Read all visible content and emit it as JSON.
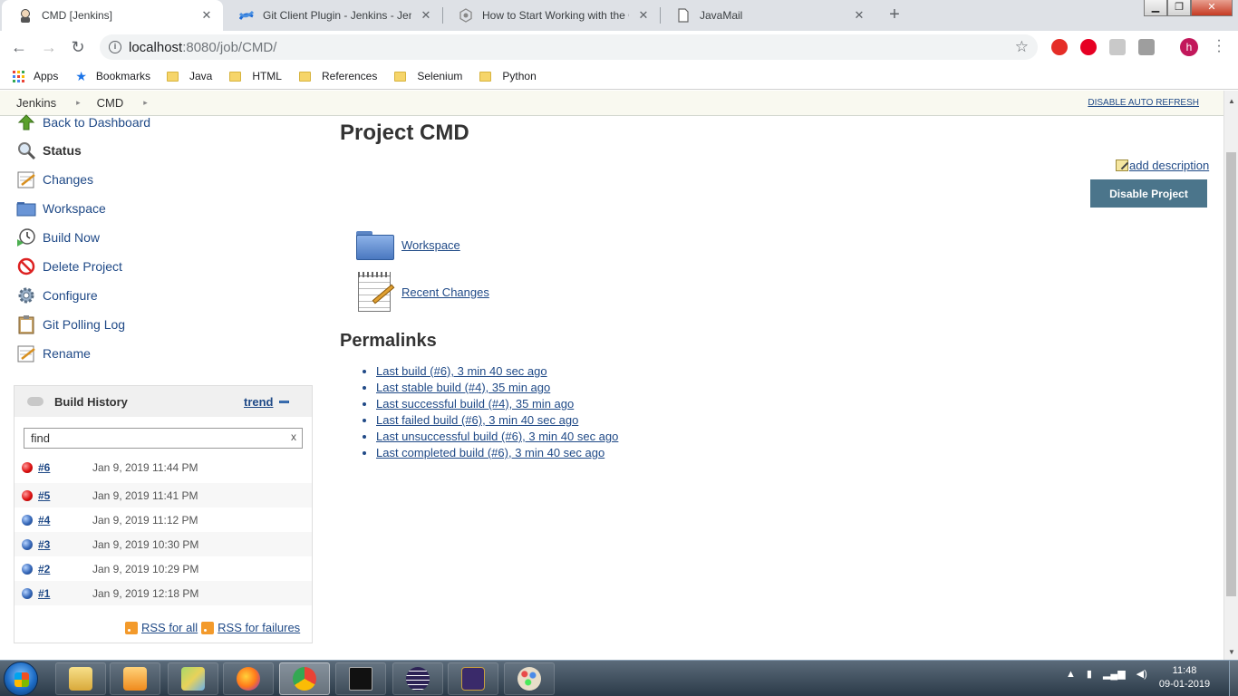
{
  "browser": {
    "tabs": [
      {
        "title": "CMD [Jenkins]",
        "close": "✕"
      },
      {
        "title": "Git Client Plugin - Jenkins - Jenkins",
        "close": "✕"
      },
      {
        "title": "How to Start Working with the Git",
        "close": "✕"
      },
      {
        "title": "JavaMail",
        "close": "✕"
      }
    ],
    "new_tab": "+",
    "url_host": "localhost",
    "url_path": ":8080/job/CMD/",
    "avatar_letter": "h",
    "bookmarks": [
      "Apps",
      "Bookmarks",
      "Java",
      "HTML",
      "References",
      "Selenium",
      "Python"
    ]
  },
  "breadcrumb": {
    "items": [
      "Jenkins",
      "CMD"
    ],
    "auto_refresh": "DISABLE AUTO REFRESH"
  },
  "sidebar": {
    "tasks": [
      {
        "label": "Back to Dashboard",
        "icon": "up-arrow-icon"
      },
      {
        "label": "Status",
        "icon": "magnifier-icon"
      },
      {
        "label": "Changes",
        "icon": "notepad-icon"
      },
      {
        "label": "Workspace",
        "icon": "folder-icon"
      },
      {
        "label": "Build Now",
        "icon": "clock-play-icon"
      },
      {
        "label": "Delete Project",
        "icon": "no-entry-icon"
      },
      {
        "label": "Configure",
        "icon": "gear-icon"
      },
      {
        "label": "Git Polling Log",
        "icon": "clipboard-icon"
      },
      {
        "label": "Rename",
        "icon": "notepad-icon"
      }
    ]
  },
  "build_history": {
    "title": "Build History",
    "trend": "trend",
    "search_value": "find",
    "clear": "x",
    "builds": [
      {
        "number": "#6",
        "date": "Jan 9, 2019 11:44 PM",
        "status": "red"
      },
      {
        "number": "#5",
        "date": "Jan 9, 2019 11:41 PM",
        "status": "red"
      },
      {
        "number": "#4",
        "date": "Jan 9, 2019 11:12 PM",
        "status": "blue"
      },
      {
        "number": "#3",
        "date": "Jan 9, 2019 10:30 PM",
        "status": "blue"
      },
      {
        "number": "#2",
        "date": "Jan 9, 2019 10:29 PM",
        "status": "blue"
      },
      {
        "number": "#1",
        "date": "Jan 9, 2019 12:18 PM",
        "status": "blue"
      }
    ],
    "rss_all": "RSS for all",
    "rss_failures": "RSS for failures"
  },
  "main": {
    "title": "Project CMD",
    "add_description": "add description",
    "disable_button": "Disable Project",
    "workspace_link": "Workspace",
    "recent_changes_link": "Recent Changes",
    "permalinks_title": "Permalinks",
    "permalinks": [
      "Last build (#6), 3 min 40 sec ago",
      "Last stable build (#4), 35 min ago",
      "Last successful build (#4), 35 min ago",
      "Last failed build (#6), 3 min 40 sec ago",
      "Last unsuccessful build (#6), 3 min 40 sec ago",
      "Last completed build (#6), 3 min 40 sec ago"
    ]
  },
  "taskbar": {
    "time": "11:48",
    "date": "09-01-2019"
  },
  "colors": {
    "link": "#204a87",
    "disable_button": "#4b758b",
    "breadcrumb_bg": "#f9f9f0",
    "failed_ball": "#dd1111",
    "success_ball": "#3466b8"
  }
}
